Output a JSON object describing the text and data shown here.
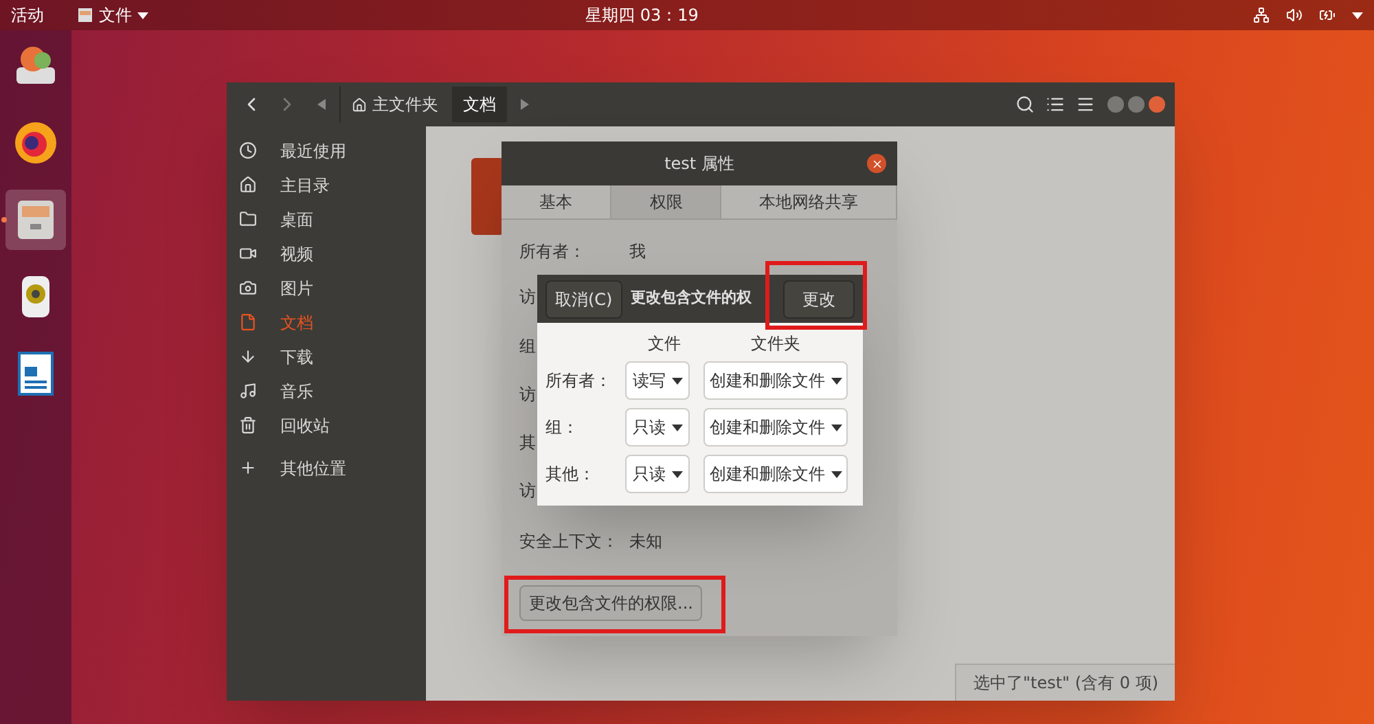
{
  "top_bar": {
    "activities": "活动",
    "app_menu": "文件",
    "clock": "星期四 03：19"
  },
  "dock": [
    {
      "kind": "installer",
      "selected": false
    },
    {
      "kind": "browser",
      "selected": false
    },
    {
      "kind": "files",
      "selected": true
    },
    {
      "kind": "speaker",
      "selected": false
    },
    {
      "kind": "writer",
      "selected": false
    }
  ],
  "file_manager": {
    "breadcrumbs": [
      {
        "label": "主文件夹",
        "kind": "home",
        "selected": false
      },
      {
        "label": "文档",
        "kind": "folder",
        "selected": true
      }
    ],
    "sidebar": [
      {
        "label": "最近使用",
        "kind": "recent",
        "selected": false
      },
      {
        "label": "主目录",
        "kind": "home",
        "selected": false
      },
      {
        "label": "桌面",
        "kind": "folder",
        "selected": false
      },
      {
        "label": "视频",
        "kind": "video",
        "selected": false
      },
      {
        "label": "图片",
        "kind": "camera",
        "selected": false
      },
      {
        "label": "文档",
        "kind": "document",
        "selected": true
      },
      {
        "label": "下载",
        "kind": "download",
        "selected": false
      },
      {
        "label": "音乐",
        "kind": "music",
        "selected": false
      },
      {
        "label": "回收站",
        "kind": "trash",
        "selected": false
      },
      {
        "label": "其他位置",
        "kind": "plus",
        "selected": false
      }
    ],
    "status": "选中了\"test\" (含有 0 项)"
  },
  "properties": {
    "title": "test 属性",
    "tabs": [
      {
        "label": "基本",
        "selected": false
      },
      {
        "label": "权限",
        "selected": true
      },
      {
        "label": "本地网络共享",
        "selected": false
      }
    ],
    "rows": [
      {
        "label": "所有者：",
        "value": "我"
      },
      {
        "label": "访"
      },
      {
        "label": "组"
      },
      {
        "label": "访"
      },
      {
        "label": "其"
      },
      {
        "label": "访"
      },
      {
        "label": "安全上下文：",
        "value": "未知"
      }
    ],
    "button": "更改包含文件的权限...",
    "button_highlighted": true
  },
  "permission_dialog": {
    "cancel": "取消(C)",
    "title": "更改包含文件的权",
    "confirm": "更改",
    "confirm_highlighted": true,
    "columns": [
      "文件",
      "文件夹"
    ],
    "rows": [
      {
        "label": "所有者：",
        "file": "读写",
        "folder": "创建和删除文件"
      },
      {
        "label": "组：",
        "file": "只读",
        "folder": "创建和删除文件"
      },
      {
        "label": "其他：",
        "file": "只读",
        "folder": "创建和删除文件"
      }
    ]
  }
}
